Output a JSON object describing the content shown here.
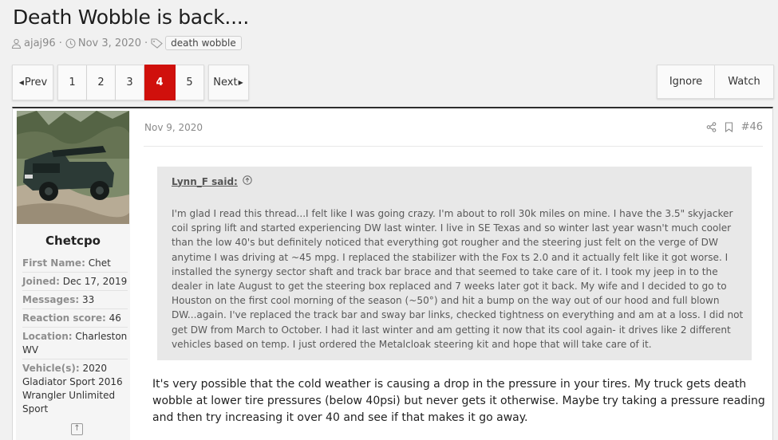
{
  "thread": {
    "title": "Death Wobble is back....",
    "author": "ajaj96",
    "date": "Nov 3, 2020",
    "tag": "death wobble"
  },
  "pagination": {
    "prev_label": "Prev",
    "next_label": "Next",
    "pages": [
      "1",
      "2",
      "3",
      "4",
      "5"
    ],
    "current_page": "4"
  },
  "thread_actions": {
    "ignore_label": "Ignore",
    "watch_label": "Watch"
  },
  "post": {
    "user": {
      "name": "Chetcpo",
      "first_name_label": "First Name:",
      "first_name": "Chet",
      "joined_label": "Joined:",
      "joined": "Dec 17, 2019",
      "messages_label": "Messages:",
      "messages": "33",
      "reaction_label": "Reaction score:",
      "reaction_score": "46",
      "location_label": "Location:",
      "location": "Charleston WV",
      "vehicles_label": "Vehicle(s):",
      "vehicles": "2020 Gladiator Sport 2016 Wrangler Unlimited Sport"
    },
    "date": "Nov 9, 2020",
    "number": "#46",
    "quote": {
      "author_label": "Lynn_F said:",
      "text": "I'm glad I read this thread...I felt like I was going crazy. I'm about to roll 30k miles on mine. I have the 3.5\" skyjacker coil spring lift and started experiencing DW last winter. I live in SE Texas and so winter last year wasn't much cooler than the low 40's but definitely noticed that everything got rougher and the steering just felt on the verge of DW anytime I was driving at ~45 mpg. I replaced the stabilizer with the Fox ts 2.0 and it actually felt like it got worse. I installed the synergy sector shaft and track bar brace and that seemed to take care of it. I took my jeep in to the dealer in late August to get the steering box replaced and 7 weeks later got it back. My wife and I decided to go to Houston on the first cool morning of the season (~50°) and hit a bump on the way out of our hood and full blown DW...again. I've replaced the track bar and sway bar links, checked tightness on everything and am at a loss. I did not get DW from March to October. I had it last winter and am getting it now that its cool again- it drives like 2 different vehicles based on temp. I just ordered the Metalcloak steering kit and hope that will take care of it."
    },
    "body": "It's very possible that the cold weather is causing a drop in the pressure in your tires. My truck gets death wobble at lower tire pressures (below 40psi) but never gets it otherwise. Maybe try taking a pressure reading and then try increasing it over 40 and see if that makes it go away."
  },
  "colors": {
    "accent": "#d0100c",
    "page_bg": "#f1f1f1",
    "quote_bg": "#e8e8e8"
  },
  "icons": [
    "user-icon",
    "clock-icon",
    "tag-icon",
    "share-icon",
    "bookmark-icon",
    "arrow-up-icon",
    "chevron-left-icon",
    "chevron-right-icon"
  ]
}
